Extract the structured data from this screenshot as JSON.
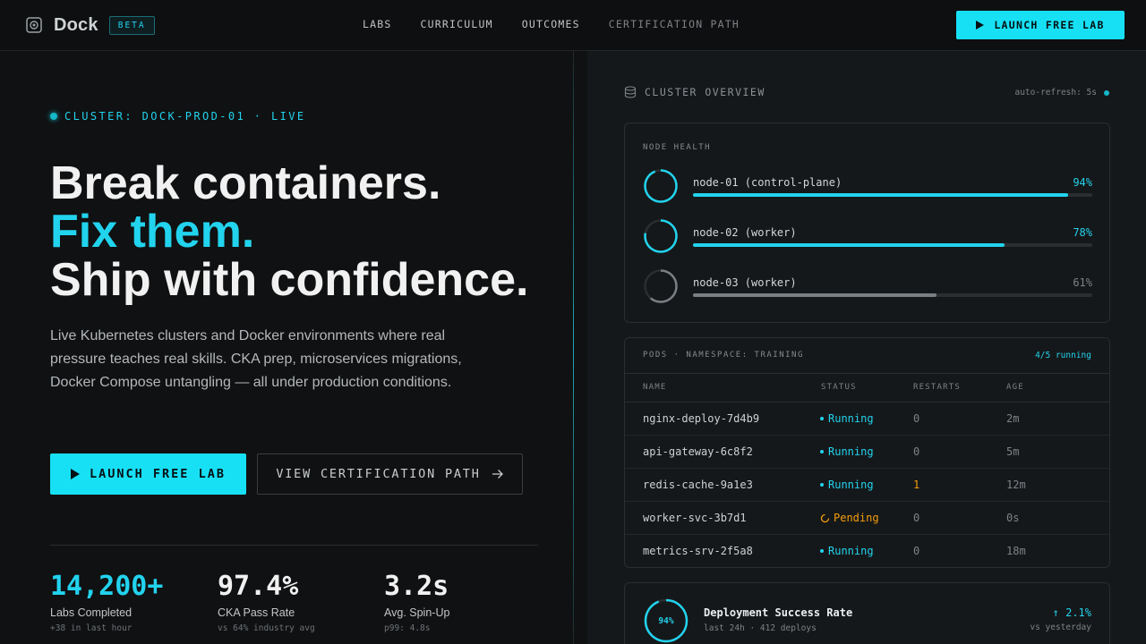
{
  "header": {
    "brand": "Dock",
    "badge": "BETA",
    "nav": [
      "LABS",
      "CURRICULUM",
      "OUTCOMES",
      "CERTIFICATION PATH"
    ],
    "cta": "LAUNCH FREE LAB"
  },
  "hero": {
    "cluster_tag": "CLUSTER: DOCK-PROD-01 · LIVE",
    "title_line1": "Break containers.",
    "title_line2": "Fix them.",
    "title_line3": "Ship with confidence.",
    "description": "Live Kubernetes clusters and Docker environments where real pressure teaches real skills. CKA prep, microservices migrations, Docker Compose untangling — all under production conditions.",
    "primary_button": "LAUNCH FREE LAB",
    "secondary_button": "VIEW CERTIFICATION PATH"
  },
  "stats": [
    {
      "value": "14,200+",
      "label": "Labs Completed",
      "sub": "+38 in last hour"
    },
    {
      "value": "97.4%",
      "label": "CKA Pass Rate",
      "sub": "vs 64% industry avg"
    },
    {
      "value": "3.2s",
      "label": "Avg. Spin-Up",
      "sub": "p99: 4.8s"
    }
  ],
  "overview": {
    "title": "CLUSTER OVERVIEW",
    "autorefresh": "auto-refresh: 5s",
    "node_health": {
      "label": "NODE HEALTH",
      "nodes": [
        {
          "name": "node-01 (control-plane)",
          "pct_text": "94%",
          "value": 0.94
        },
        {
          "name": "node-02 (worker)",
          "pct_text": "78%",
          "value": 0.78
        },
        {
          "name": "node-03 (worker)",
          "pct_text": "61%",
          "value": 0.61
        }
      ]
    },
    "pods": {
      "label": "PODS · NAMESPACE: TRAINING",
      "count": "4/5 running",
      "columns": [
        "NAME",
        "STATUS",
        "RESTARTS",
        "AGE"
      ],
      "rows": [
        {
          "name": "nginx-deploy-7d4b9",
          "status": "Running",
          "restarts": "0",
          "age": "2m"
        },
        {
          "name": "api-gateway-6c8f2",
          "status": "Running",
          "restarts": "0",
          "age": "5m"
        },
        {
          "name": "redis-cache-9a1e3",
          "status": "Running",
          "restarts": "1",
          "age": "12m"
        },
        {
          "name": "worker-svc-3b7d1",
          "status": "Pending",
          "restarts": "0",
          "age": "0s"
        },
        {
          "name": "metrics-srv-2f5a8",
          "status": "Running",
          "restarts": "0",
          "age": "18m"
        }
      ]
    },
    "deploy": {
      "ring_text": "94%",
      "value": 0.94,
      "title": "Deployment Success Rate",
      "sub": "last 24h · 412 deploys",
      "delta": "↑ 2.1%",
      "vs": "vs yesterday"
    }
  },
  "colors": {
    "accent": "#22d3ee",
    "warning": "#f59e0b",
    "background": "#101112"
  }
}
